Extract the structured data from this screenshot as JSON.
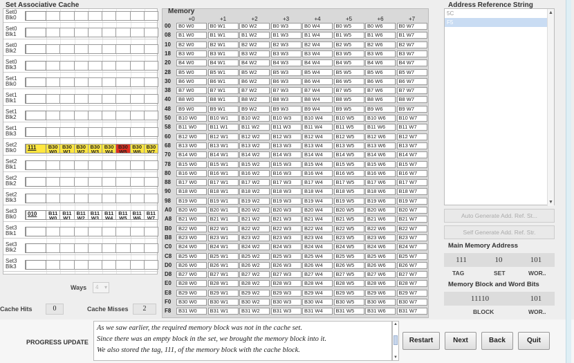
{
  "cache": {
    "title": "Set Associative Cache",
    "rows": [
      {
        "label": "Set0\nBlk0",
        "tag": "",
        "words": []
      },
      {
        "label": "Set0\nBlk1",
        "tag": "",
        "words": []
      },
      {
        "label": "Set0\nBlk2",
        "tag": "",
        "words": []
      },
      {
        "label": "Set0\nBlk3",
        "tag": "",
        "words": []
      },
      {
        "label": "Set1\nBlk0",
        "tag": "",
        "words": []
      },
      {
        "label": "Set1\nBlk1",
        "tag": "",
        "words": []
      },
      {
        "label": "Set1\nBlk2",
        "tag": "",
        "words": []
      },
      {
        "label": "Set1\nBlk3",
        "tag": "",
        "words": []
      },
      {
        "label": "Set2\nBlk0",
        "tag": "111",
        "words": [
          "B30\nW0",
          "B30\nW1",
          "B30\nW2",
          "B30\nW3",
          "B30\nW4",
          "B30\nW5",
          "B30\nW6",
          "B30\nW7"
        ],
        "highlight": "yellow",
        "hit_index": 5
      },
      {
        "label": "Set2\nBlk1",
        "tag": "",
        "words": []
      },
      {
        "label": "Set2\nBlk2",
        "tag": "",
        "words": []
      },
      {
        "label": "Set2\nBlk3",
        "tag": "",
        "words": []
      },
      {
        "label": "Set3\nBlk0",
        "tag": "010",
        "words": [
          "B11\nW0",
          "B11\nW1",
          "B11\nW2",
          "B11\nW3",
          "B11\nW4",
          "B11\nW5",
          "B11\nW6",
          "B11\nW7"
        ]
      },
      {
        "label": "Set3\nBlk1",
        "tag": "",
        "words": []
      },
      {
        "label": "Set3\nBlk2",
        "tag": "",
        "words": []
      },
      {
        "label": "Set3\nBlk3",
        "tag": "",
        "words": []
      }
    ],
    "ways_label": "Ways",
    "ways_value": "4",
    "hits_label": "Cache Hits",
    "hits_value": "0",
    "misses_label": "Cache Misses",
    "misses_value": "2"
  },
  "memory": {
    "title": "Memory",
    "columns": [
      "+0",
      "+1",
      "+2",
      "+3",
      "+4",
      "+5",
      "+6",
      "+7"
    ],
    "addresses": [
      "00",
      "08",
      "10",
      "18",
      "20",
      "28",
      "30",
      "38",
      "40",
      "48",
      "50",
      "58",
      "60",
      "68",
      "70",
      "78",
      "80",
      "88",
      "90",
      "98",
      "A0",
      "A8",
      "B0",
      "B8",
      "C0",
      "C8",
      "D0",
      "D8",
      "E0",
      "E8",
      "F0",
      "F8"
    ]
  },
  "address_reference": {
    "title": "Address Reference String",
    "items": [
      "5C",
      "F5"
    ],
    "selected_index": 1,
    "auto_button": "Auto Generate Add. Ref. St...",
    "self_button": "Self Generate Add. Ref. Str."
  },
  "main_memory_address": {
    "title": "Main Memory Address",
    "tag_value": "111",
    "set_value": "10",
    "word_value": "101",
    "tag_label": "TAG",
    "set_label": "SET",
    "word_label": "WOR.."
  },
  "block_word_bits": {
    "title": "Memory Block and Word Bits",
    "block_value": "11110",
    "word_value": "101",
    "block_label": "BLOCK",
    "word_label": "WOR.."
  },
  "progress": {
    "label": "PROGRESS UPDATE",
    "lines": [
      "As we saw earlier, the required memory block was not in the cache set.",
      "Since there was an empty block in the set, we brought the memory block into it.",
      "We also stored the tag, 111, of the memory block with the cache block."
    ]
  },
  "buttons": {
    "restart": "Restart",
    "next": "Next",
    "back": "Back",
    "quit": "Quit"
  }
}
